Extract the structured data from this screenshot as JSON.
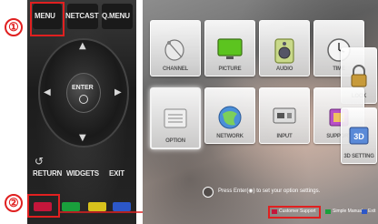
{
  "callouts": {
    "one": "①",
    "two": "②"
  },
  "remote": {
    "menu": "MENU",
    "netcast": "NETCAST",
    "qmenu": "Q.MENU",
    "enter": "ENTER",
    "return": "RETURN",
    "widgets": "WIDGETS",
    "exit": "EXIT"
  },
  "tv_menu": {
    "tiles": [
      {
        "label": "CHANNEL",
        "icon": "satellite-dish-icon"
      },
      {
        "label": "PICTURE",
        "icon": "monitor-icon"
      },
      {
        "label": "AUDIO",
        "icon": "speaker-icon"
      },
      {
        "label": "TIME",
        "icon": "clock-icon"
      },
      {
        "label": "LOCK",
        "icon": "lock-icon"
      },
      {
        "label": "OPTION",
        "icon": "option-icon"
      },
      {
        "label": "NETWORK",
        "icon": "globe-icon"
      },
      {
        "label": "INPUT",
        "icon": "input-icon"
      },
      {
        "label": "SUPPORT",
        "icon": "support-icon"
      },
      {
        "label": "3D SETTING",
        "icon": "3d-icon"
      }
    ],
    "hint": "Press Enter(◉) to set your option settings.",
    "bottom": {
      "customer_support": "Customer Support",
      "simple_manual": "Simple Manual",
      "exit": "Exit"
    }
  },
  "colors": {
    "highlight": "#e02020",
    "red_key": "#c4163b",
    "green_key": "#19a03c",
    "yellow_key": "#d8c21c",
    "blue_key": "#2c57c8"
  }
}
